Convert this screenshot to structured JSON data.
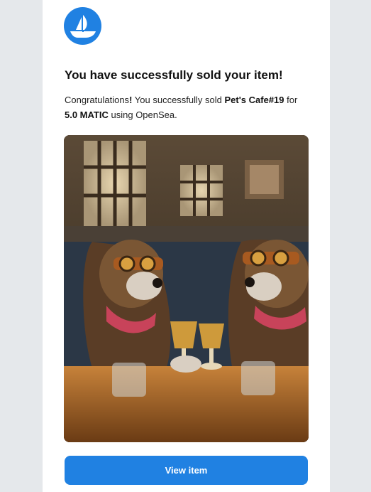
{
  "brand": {
    "logo_icon": "opensea-boat-icon",
    "color": "#2081e2"
  },
  "email": {
    "heading": "You have successfully sold your item!",
    "body": {
      "intro": "Congratulations",
      "exclaim": "!",
      "sold_text": " You successfully sold ",
      "item_name": "Pet's Cafe#19",
      "for_text": " for",
      "price": "5.0 MATIC",
      "using_text": " using OpenSea."
    },
    "image": {
      "icon": "artwork-image",
      "subject": "two dogs with goggles drinking at a cafe table"
    },
    "cta_label": "View item"
  }
}
